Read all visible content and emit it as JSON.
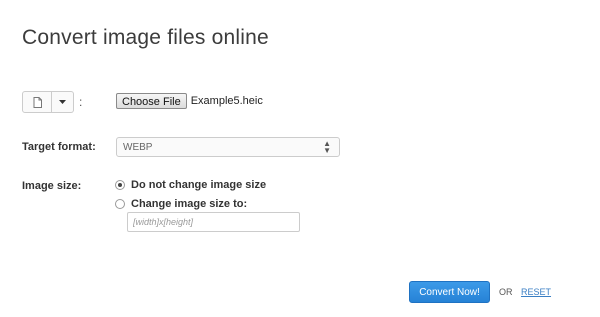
{
  "page": {
    "title": "Convert image files online"
  },
  "source": {
    "colon": ":",
    "file_button_icon": "file-icon",
    "dropdown_icon": "caret-down-icon",
    "choose_file_label": "Choose File",
    "file_name": "Example5.heic"
  },
  "target_format": {
    "label": "Target format:",
    "selected": "WEBP"
  },
  "image_size": {
    "label": "Image size:",
    "options": [
      {
        "label": "Do not change image size",
        "checked": true
      },
      {
        "label": "Change image size to:",
        "checked": false
      }
    ],
    "input_placeholder": "[width]x[height]"
  },
  "actions": {
    "convert_label": "Convert Now!",
    "or_text": "OR",
    "reset_label": "RESET"
  },
  "colors": {
    "primary": "#2682d6",
    "link": "#3b7fc4"
  }
}
